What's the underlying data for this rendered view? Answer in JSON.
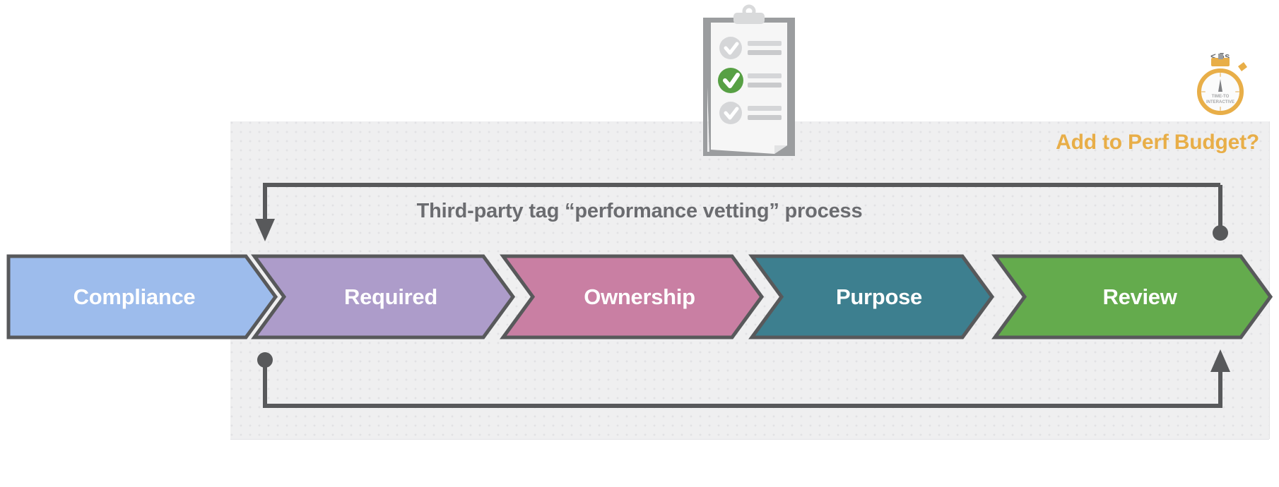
{
  "panel": {
    "perf_budget_label": "Add to Perf Budget?",
    "process_title": "Third-party tag “performance vetting” process"
  },
  "stages": [
    {
      "label": "Compliance",
      "color": "#9dbcec",
      "order": 1
    },
    {
      "label": "Required",
      "color": "#ad9cca",
      "order": 2
    },
    {
      "label": "Ownership",
      "color": "#c97fa3",
      "order": 3
    },
    {
      "label": "Purpose",
      "color": "#3d7f8f",
      "order": 4
    },
    {
      "label": "Review",
      "color": "#64ab4d",
      "order": 5
    }
  ],
  "stopwatch": {
    "threshold_label": "< 5s",
    "dial_line1": "TIME-TO",
    "dial_line2": "INTERACTIVE",
    "accent_color": "#e8ae48"
  },
  "clipboard": {
    "checklist_items": [
      {
        "state": "unchecked",
        "check_color": "#c9cacc"
      },
      {
        "state": "checked",
        "check_color": "#57a044"
      },
      {
        "state": "unchecked",
        "check_color": "#c9cacc"
      }
    ]
  },
  "loops": {
    "top_arrow_direction": "down",
    "top_origin_marker": "dot",
    "bottom_arrow_direction": "up",
    "bottom_origin_marker": "dot",
    "line_color": "#58595b"
  },
  "colors": {
    "panel_background": "#efeff0",
    "stroke": "#58595b",
    "title_text": "#6b6c70",
    "accent": "#e8ae48"
  }
}
